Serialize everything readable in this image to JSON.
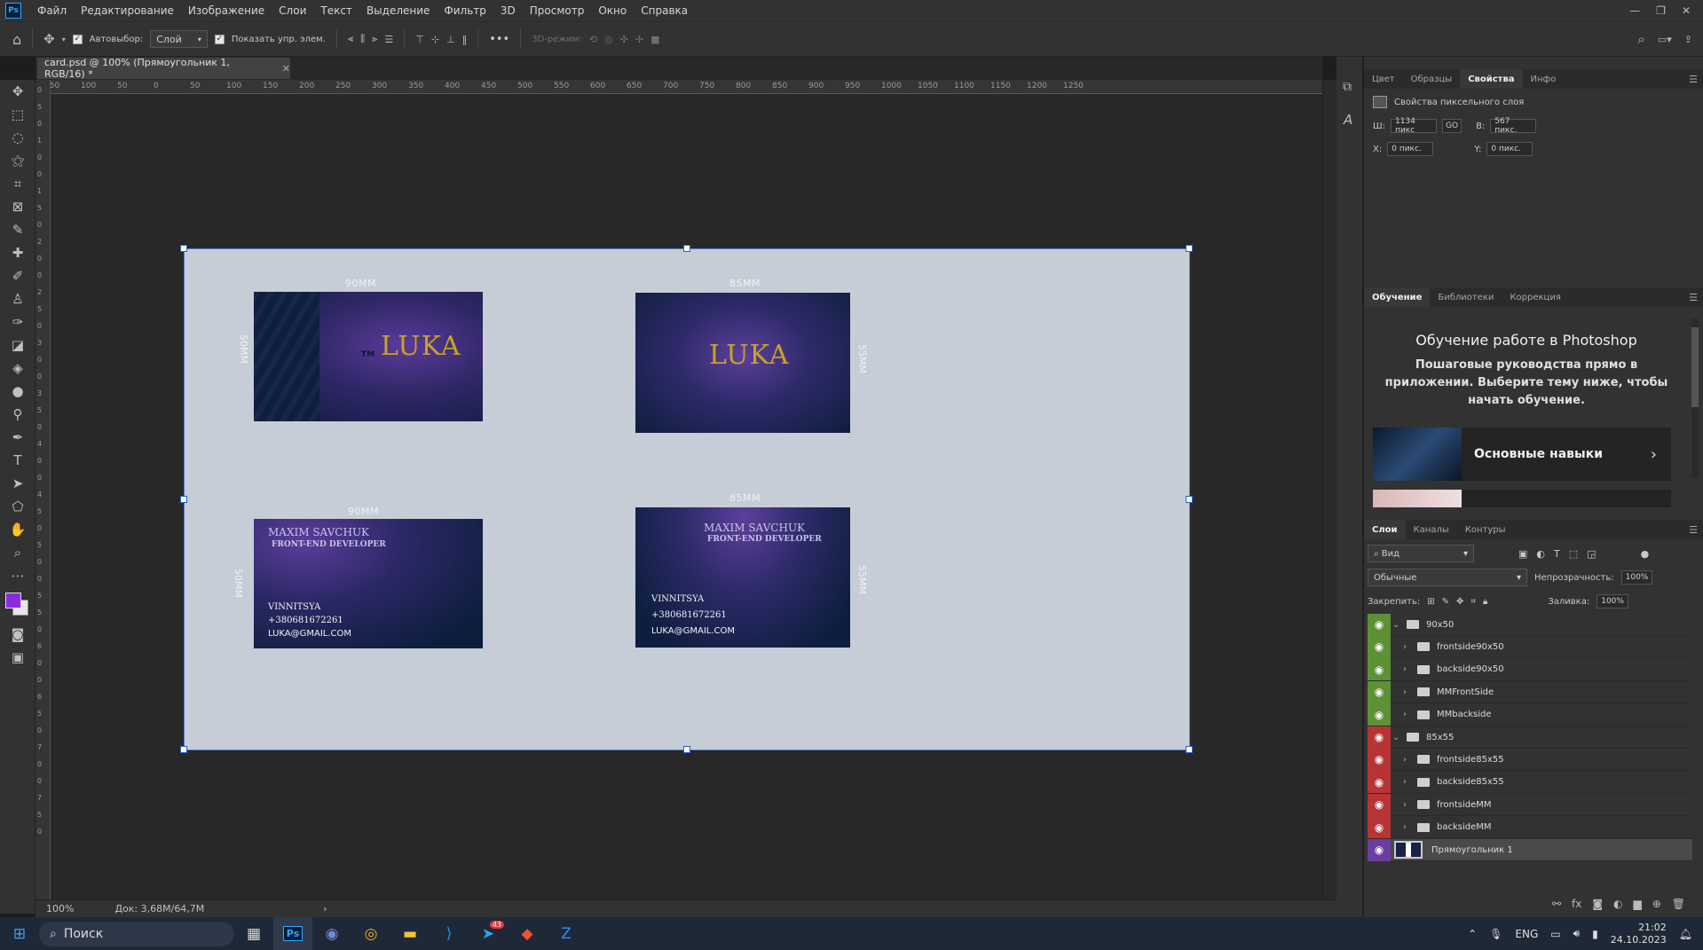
{
  "menu": {
    "app_logo": "Ps",
    "items": [
      "Файл",
      "Редактирование",
      "Изображение",
      "Слои",
      "Текст",
      "Выделение",
      "Фильтр",
      "3D",
      "Просмотр",
      "Окно",
      "Справка"
    ]
  },
  "options": {
    "autoselect_label": "Автовыбор:",
    "autoselect_value": "Слой",
    "show_controls_label": "Показать упр. элем.",
    "more": "•••",
    "mode_3d": "3D-режим:"
  },
  "document": {
    "tab_title": "card.psd @ 100% (Прямоугольник 1, RGB/16) *",
    "zoom": "100%",
    "doc_info": "Док: 3,68M/64,7M"
  },
  "rulers": {
    "top": [
      "150",
      "100",
      "50",
      "0",
      "50",
      "100",
      "150",
      "200",
      "250",
      "300",
      "350",
      "400",
      "450",
      "500",
      "550",
      "600",
      "650",
      "700",
      "750",
      "800",
      "850",
      "900",
      "950",
      "1000",
      "1050",
      "1100",
      "1150",
      "1200",
      "1250"
    ],
    "left": [
      "0",
      "5",
      "0",
      "1",
      "0",
      "0",
      "1",
      "5",
      "0",
      "2",
      "0",
      "0",
      "2",
      "5",
      "0",
      "3",
      "0",
      "0",
      "3",
      "5",
      "0",
      "4",
      "0",
      "0",
      "4",
      "5",
      "0",
      "5",
      "0",
      "0",
      "5",
      "5",
      "0",
      "6",
      "0",
      "0",
      "6",
      "5",
      "0",
      "7",
      "0",
      "0",
      "7",
      "5",
      "0"
    ]
  },
  "cards": {
    "front90": {
      "width_label": "90MM",
      "height_label": "50MM",
      "tm": "TM",
      "logo": "LUKA"
    },
    "front85": {
      "width_label": "85MM",
      "height_label": "55MM",
      "logo": "LUKA"
    },
    "back90": {
      "width_label": "90MM",
      "height_label": "50MM",
      "name": "MAXIM SAVCHUK",
      "role": "FRONT-END DEVELOPER",
      "city": "VINNITSYA",
      "phone": "+380681672261",
      "email": "LUKA@GMAIL.COM"
    },
    "back85": {
      "width_label": "85MM",
      "height_label": "55MM",
      "name": "MAXIM SAVCHUK",
      "role": "FRONT-END DEVELOPER",
      "city": "VINNITSYA",
      "phone": "+380681672261",
      "email": "LUKA@GMAIL.COM"
    }
  },
  "properties": {
    "tabs": [
      "Цвет",
      "Образцы",
      "Свойства",
      "Инфо"
    ],
    "active_tab": "Свойства",
    "header": "Свойства пиксельного слоя",
    "w_label": "Ш:",
    "w_value": "1134 пикс",
    "link": "GO",
    "h_label": "В:",
    "h_value": "567 пикс.",
    "x_label": "X:",
    "x_value": "0 пикс.",
    "y_label": "Y:",
    "y_value": "0 пикс."
  },
  "learn": {
    "tabs": [
      "Обучение",
      "Библиотеки",
      "Коррекция"
    ],
    "title": "Обучение работе в Photoshop",
    "subtitle": "Пошаговые руководства прямо в приложении. Выберите тему ниже, чтобы начать обучение.",
    "card_label": "Основные навыки"
  },
  "layers": {
    "tabs": [
      "Слои",
      "Каналы",
      "Контуры"
    ],
    "filter": "Вид",
    "blend": "Обычные",
    "opacity_label": "Непрозрачность:",
    "opacity_value": "100%",
    "lock_label": "Закрепить:",
    "fill_label": "Заливка:",
    "fill_value": "100%",
    "items": [
      {
        "name": "90x50",
        "color": "#5d9135",
        "indent": 0,
        "open": true
      },
      {
        "name": "frontside90x50",
        "color": "#5d9135",
        "indent": 1,
        "open": false
      },
      {
        "name": "backside90x50",
        "color": "#5d9135",
        "indent": 1,
        "open": false
      },
      {
        "name": "MMFrontSide",
        "color": "#5d9135",
        "indent": 1,
        "open": false
      },
      {
        "name": "MMbackside",
        "color": "#5d9135",
        "indent": 1,
        "open": false
      },
      {
        "name": "85x55",
        "color": "#b83434",
        "indent": 0,
        "open": true
      },
      {
        "name": "frontside85x55",
        "color": "#b83434",
        "indent": 1,
        "open": false
      },
      {
        "name": "backside85x55",
        "color": "#b83434",
        "indent": 1,
        "open": false
      },
      {
        "name": "frontsideMM",
        "color": "#b83434",
        "indent": 1,
        "open": false
      },
      {
        "name": "backsideMM",
        "color": "#b83434",
        "indent": 1,
        "open": false
      },
      {
        "name": "Прямоугольник 1",
        "color": "#6a3ea0",
        "indent": 0,
        "open": false,
        "pixel": true
      }
    ]
  },
  "taskbar": {
    "search": "Поиск",
    "lang": "ENG",
    "time": "21:02",
    "date": "24.10.2023",
    "badge": "43"
  },
  "colors": {
    "foreground": "#8a2be2",
    "background": "#e6e6e6",
    "accent": "#31a8ff"
  }
}
